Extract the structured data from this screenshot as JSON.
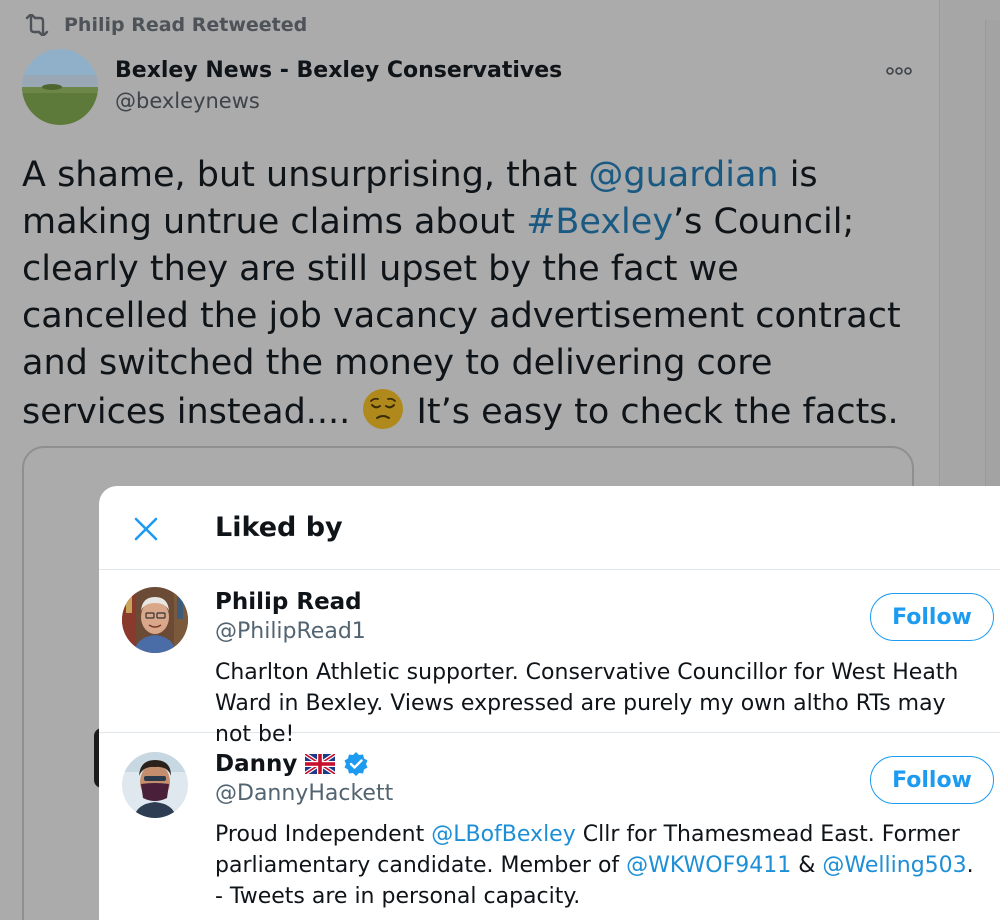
{
  "retweet": {
    "label": "Philip Read Retweeted"
  },
  "tweet": {
    "author_name": "Bexley News - Bexley Conservatives",
    "author_handle": "@bexleynews",
    "text": {
      "t1": "A shame, but unsurprising, that ",
      "mention": "@guardian",
      "t2": " is making untrue claims about ",
      "hashtag": "#Bexley",
      "t3": "’s Council; clearly they are still upset by the fact we cancelled the job vacancy advertisement contract and switched the money to delivering core services instead.... ",
      "t4": " It’s easy to check the facts."
    },
    "emoji": "pensive-face"
  },
  "modal": {
    "title": "Liked by",
    "users": [
      {
        "name": "Philip Read",
        "handle": "@PhilipRead1",
        "follow_label": "Follow",
        "bio": "Charlton Athletic supporter. Conservative Councillor for West Heath Ward in Bexley. Views expressed are purely my own altho RTs may not be!"
      },
      {
        "name": "Danny",
        "handle": "@DannyHackett",
        "follow_label": "Follow",
        "bio": {
          "b1": "Proud Independent ",
          "m1": "@LBofBexley",
          "b2": " Cllr for Thamesmead East. Former parliamentary candidate. Member of ",
          "m2": "@WKWOF9411",
          "b3": " & ",
          "m3": "@Welling503",
          "b4": ". - Tweets are in personal capacity."
        },
        "badges": [
          "uk-flag-icon",
          "verified-icon"
        ]
      }
    ]
  },
  "colors": {
    "accent": "#1d9bf0",
    "link_dim": "#1a5a82",
    "overlay": "#ababab"
  }
}
